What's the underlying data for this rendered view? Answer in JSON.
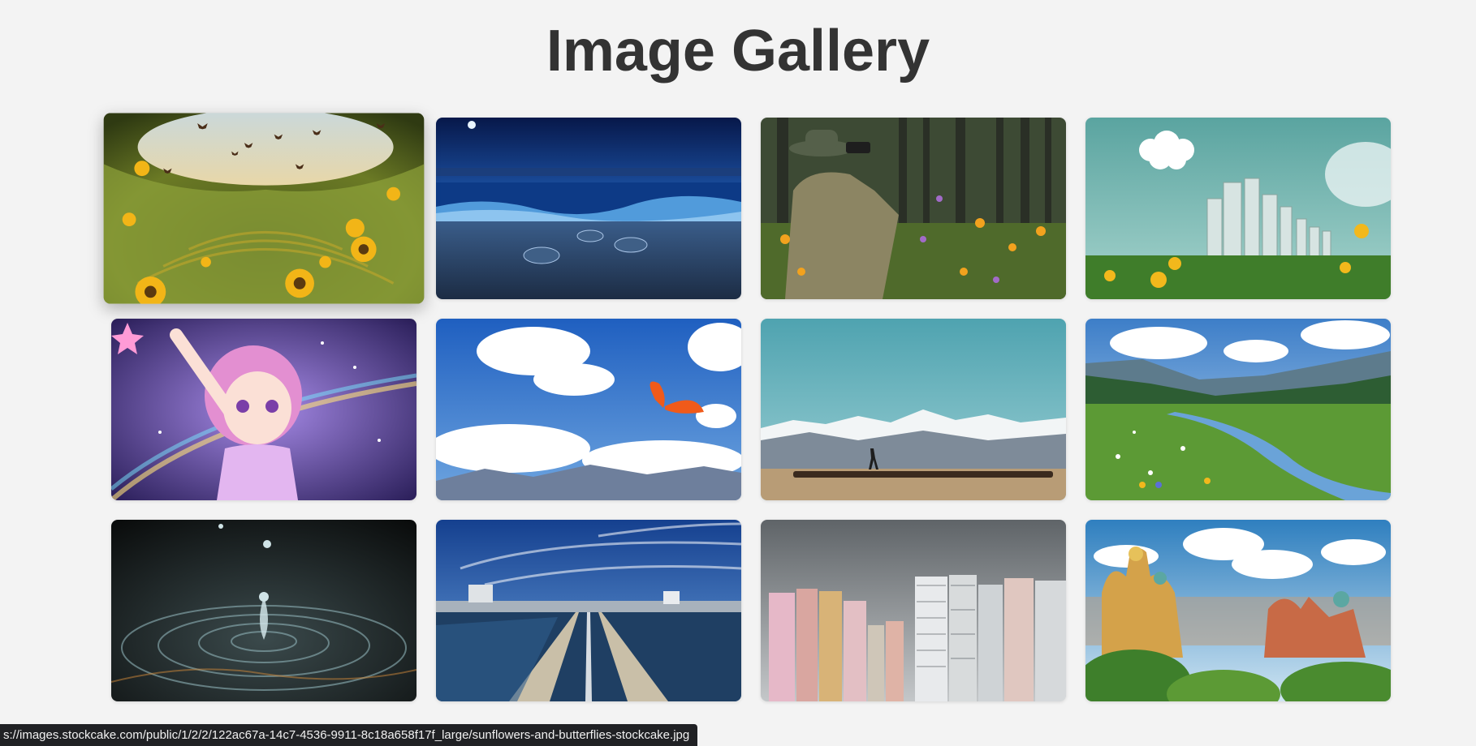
{
  "page": {
    "title": "Image Gallery"
  },
  "gallery": {
    "images": [
      {
        "name": "sunflowers-and-butterflies",
        "hovered": true
      },
      {
        "name": "sea-turtles-night-beach",
        "hovered": false
      },
      {
        "name": "birdwatcher-wildflowers",
        "hovered": false
      },
      {
        "name": "green-city-flowers",
        "hovered": false
      },
      {
        "name": "anime-magical-girl",
        "hovered": false
      },
      {
        "name": "orange-butterfly-sky",
        "hovered": false
      },
      {
        "name": "horses-mountain-plain",
        "hovered": false
      },
      {
        "name": "meadow-stream-valley",
        "hovered": false
      },
      {
        "name": "water-droplet-splash",
        "hovered": false
      },
      {
        "name": "water-treatment-channels",
        "hovered": false
      },
      {
        "name": "city-highrise-buildings",
        "hovered": false
      },
      {
        "name": "ornate-palace-city",
        "hovered": false
      }
    ]
  },
  "status_bar": {
    "url": "s://images.stockcake.com/public/1/2/2/122ac67a-14c7-4536-9911-8c18a658f17f_large/sunflowers-and-butterflies-stockcake.jpg"
  }
}
